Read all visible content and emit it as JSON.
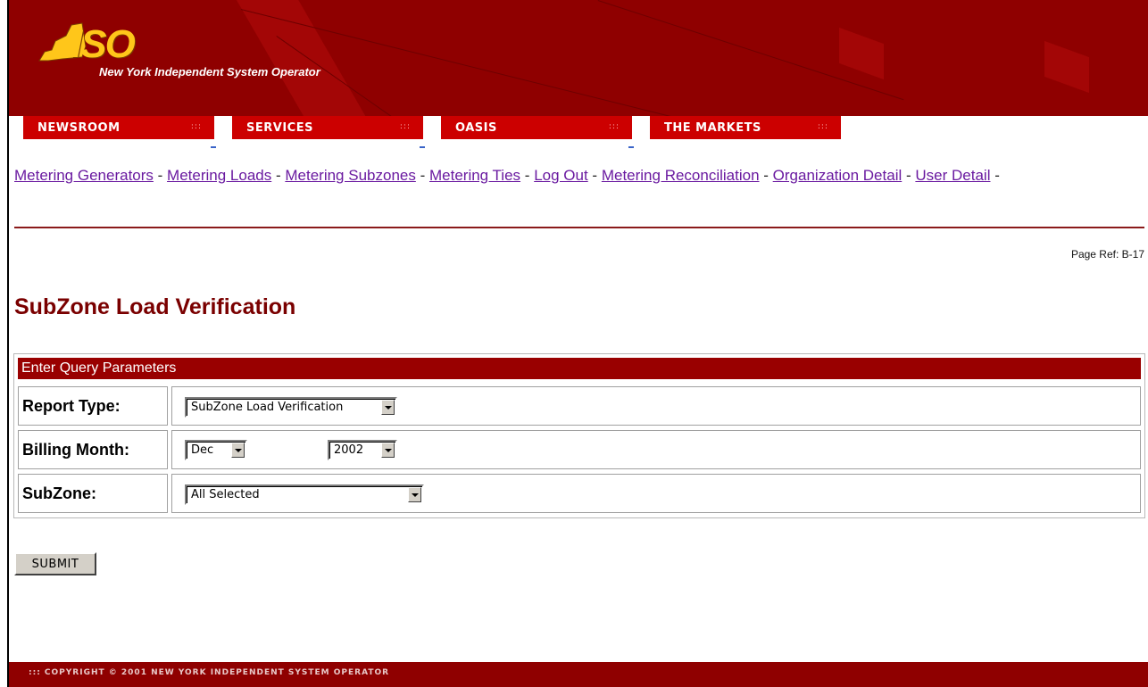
{
  "header": {
    "logo_text": "ISO",
    "tagline": "New York Independent System Operator",
    "colors": {
      "banner": "#8f0000",
      "tab": "#cc0000",
      "logo": "#ffc61a"
    }
  },
  "nav": {
    "tabs": [
      {
        "label": "NEWSROOM",
        "dots": ":::"
      },
      {
        "label": "SERVICES",
        "dots": ":::"
      },
      {
        "label": "OASIS",
        "dots": ":::"
      },
      {
        "label": "THE MARKETS",
        "dots": ":::"
      }
    ]
  },
  "sublinks": [
    "Metering Generators",
    "Metering Loads",
    "Metering Subzones",
    "Metering Ties",
    "Log Out",
    "Metering Reconciliation",
    "Organization Detail",
    "User Detail"
  ],
  "separator": "-",
  "page_ref": "Page Ref: B-17",
  "page_title": "SubZone Load Verification",
  "query": {
    "header": "Enter Query Parameters",
    "report_type": {
      "label": "Report Type:",
      "value": "SubZone Load Verification"
    },
    "billing_month": {
      "label": "Billing Month:",
      "month": "Dec",
      "year": "2002"
    },
    "subzone": {
      "label": "SubZone:",
      "value": "All Selected"
    }
  },
  "submit_label": "SUBMIT",
  "footer": ":::  COPYRIGHT © 2001 NEW YORK INDEPENDENT SYSTEM OPERATOR"
}
